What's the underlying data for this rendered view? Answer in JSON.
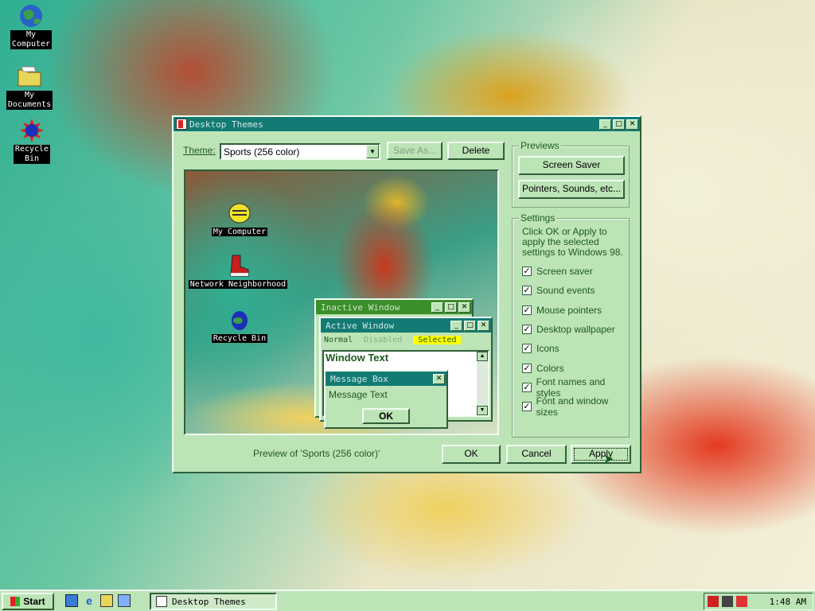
{
  "desktop": {
    "icons": [
      {
        "label": "My\nComputer",
        "icon": "globe-icon"
      },
      {
        "label": "My\nDocuments",
        "icon": "folder-icon"
      },
      {
        "label": "Recycle\nBin",
        "icon": "recycle-bin-icon"
      }
    ]
  },
  "dialog": {
    "title": "Desktop Themes",
    "theme_label": "Theme:",
    "theme_value": "Sports (256 color)",
    "save_as": "Save As...",
    "delete": "Delete",
    "preview_caption": "Preview of 'Sports (256 color)'",
    "ok": "OK",
    "cancel": "Cancel",
    "apply": "Apply",
    "previews": {
      "title": "Previews",
      "screen_saver": "Screen Saver",
      "pointers": "Pointers, Sounds, etc..."
    },
    "settings": {
      "title": "Settings",
      "description": "Click OK or Apply to apply the selected settings to Windows 98.",
      "items": [
        {
          "label": "Screen saver",
          "checked": true
        },
        {
          "label": "Sound events",
          "checked": true
        },
        {
          "label": "Mouse pointers",
          "checked": true
        },
        {
          "label": "Desktop wallpaper",
          "checked": true
        },
        {
          "label": "Icons",
          "checked": true
        },
        {
          "label": "Colors",
          "checked": true
        },
        {
          "label": "Font names and styles",
          "checked": true
        },
        {
          "label": "Font and window sizes",
          "checked": true
        }
      ]
    }
  },
  "preview": {
    "icons": [
      "My Computer",
      "Network Neighborhood",
      "Recycle Bin"
    ],
    "inactive_title": "Inactive Window",
    "active_title": "Active Window",
    "menu": {
      "normal": "Normal",
      "disabled": "Disabled",
      "selected": "Selected"
    },
    "window_text": "Window Text",
    "message_box_title": "Message Box",
    "message_text": "Message Text",
    "ok": "OK"
  },
  "taskbar": {
    "start": "Start",
    "task": "Desktop Themes",
    "clock": "1:48 AM"
  },
  "colors": {
    "face": "#bde4b7",
    "titlebar": "#137a74",
    "selected_bg": "#ffff00"
  }
}
